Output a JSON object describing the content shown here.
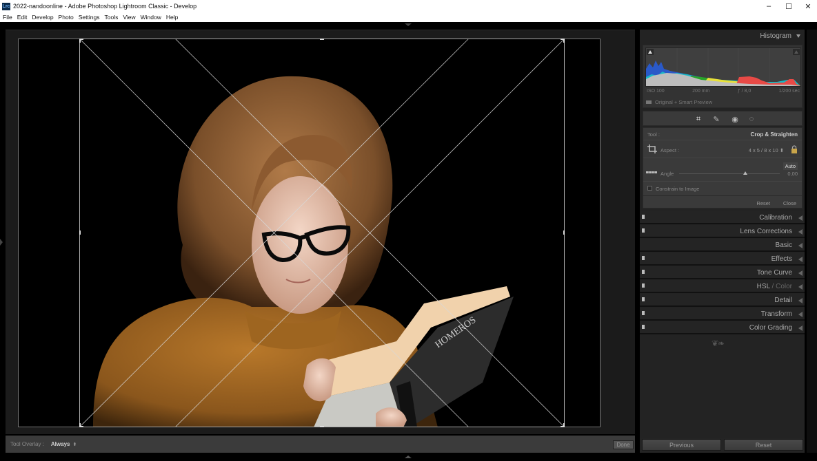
{
  "window": {
    "title": "2022-nandoonline - Adobe Photoshop Lightroom Classic - Develop",
    "app_icon_text": "Lrc",
    "controls": {
      "minimize": "–",
      "maximize": "☐",
      "close": "✕"
    }
  },
  "menu": [
    "File",
    "Edit",
    "Develop",
    "Photo",
    "Settings",
    "Tools",
    "View",
    "Window",
    "Help"
  ],
  "toolbar": {
    "tool_overlay_label": "Tool Overlay :",
    "tool_overlay_value": "Always",
    "tool_overlay_arrows": "⬍",
    "done_label": "Done"
  },
  "histogram": {
    "title": "Histogram",
    "iso": "ISO 100",
    "focal_length": "200 mm",
    "aperture": "ƒ / 8,0",
    "shutter": "1/200 sec",
    "preview_status": "Original + Smart Preview"
  },
  "tools": {
    "icons": [
      "crop-icon",
      "heal-icon",
      "redeye-icon",
      "mask-icon"
    ],
    "glyphs": [
      "⌗",
      "✎",
      "◉",
      "◌"
    ]
  },
  "crop_panel": {
    "tool_label": "Tool :",
    "tool_name": "Crop & Straighten",
    "aspect_label": "Aspect :",
    "aspect_value": "4 x 5  /  8 x 10 ⬍",
    "auto_label": "Auto",
    "angle_label": "Angle",
    "angle_value": "0,00",
    "angle_fraction": 0.5,
    "constrain_label": "Constrain to Image",
    "constrain_checked": false,
    "reset_label": "Reset",
    "close_label": "Close"
  },
  "panels": [
    {
      "label": "Calibration",
      "switch": true
    },
    {
      "label": "Lens Corrections",
      "switch": true
    },
    {
      "label": "Basic",
      "switch": false
    },
    {
      "label": "Effects",
      "switch": true
    },
    {
      "label": "Tone Curve",
      "switch": true
    },
    {
      "label": "HSL",
      "label_dim": " / Color",
      "switch": true
    },
    {
      "label": "Detail",
      "switch": true
    },
    {
      "label": "Transform",
      "switch": true
    },
    {
      "label": "Color Grading",
      "switch": true
    }
  ],
  "ornament": "❦❧",
  "bottom_buttons": {
    "previous": "Previous",
    "reset": "Reset"
  },
  "photo": {
    "description": "Girl with glasses in mustard sweater reading a book on black background",
    "book_title": "HOMEROS"
  }
}
